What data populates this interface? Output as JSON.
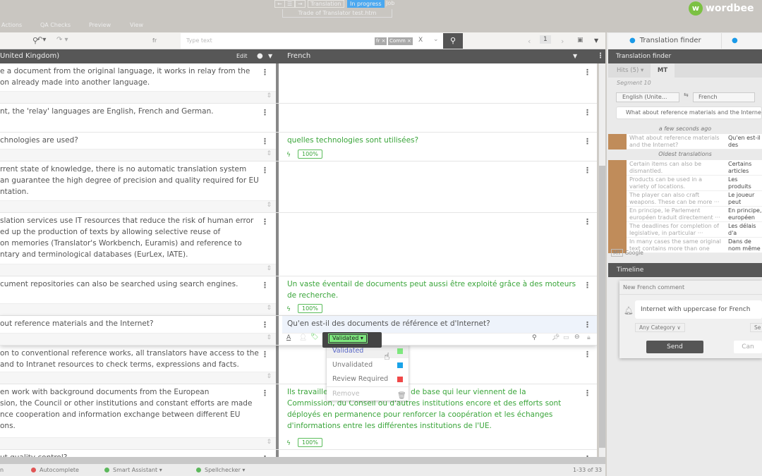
{
  "top": {
    "nav_back": "←",
    "nav_list": "☰",
    "nav_fwd": "→",
    "step": "Translation",
    "status": "In progress",
    "job": "Job",
    "file": "Trade of Translator test.htm",
    "logo": "wordbee"
  },
  "menu": [
    "Actions",
    "QA Checks",
    "Preview",
    "View"
  ],
  "toolbar": {
    "lang": "fr",
    "search_placeholder": "Type text",
    "chips": [
      "fr ×",
      "Comm ×"
    ],
    "clear": "X",
    "page": "1"
  },
  "header": {
    "source": "United Kingdom)",
    "edit": "Edit",
    "target": "French"
  },
  "rows": [
    {
      "src": "e a document from the original language, it works in relay from the\non already made into another language.",
      "tgt": "",
      "h": 57
    },
    {
      "src": "nt, the 'relay' languages are English, French and German.",
      "tgt": "",
      "h": 41
    },
    {
      "src": "chnologies are used?",
      "tgt": "quelles technologies sont utilisées?",
      "badge": "100%",
      "h": 41
    },
    {
      "src": "rrent state of knowledge, there is no automatic translation system\nan guarantee the high degree of precision and quality required for EU\nntation.",
      "tgt": "",
      "h": 73
    },
    {
      "src": "slation services use IT resources that reduce the risk of human error\ned up the production of texts by allowing selective reuse of\non memories (Translator's Workbench, Euramis) and reference to\nntary and terminological databases (EurLex, IATE).",
      "tgt": "",
      "h": 90
    },
    {
      "src": "cument repositories can also be searched using search engines.",
      "tgt": "Un vaste éventail de documents peut aussi être exploité grâce à des moteurs\nde recherche.",
      "badge": "100%",
      "h": 56
    },
    {
      "src": "out reference materials and the Internet?",
      "tgt": "Qu'en est-il des documents de référence et d'Internet?",
      "h": 42,
      "active": true
    },
    {
      "src": "on to conventional reference works, all translators have access to the\nand to Intranet resources to check terms, expressions and facts.",
      "tgt": "",
      "h": 55
    },
    {
      "src": "en work with background documents from the European\nsion, the Council or other institutions and constant efforts are made\nnce cooperation and information exchange between different EU\nons.",
      "tgt": "Ils travaillent sur des documents de base qui leur viennent de la\nCommission, du Conseil ou d'autres institutions encore et des efforts sont\ndéployés en permanence pour renforcer la coopération et les échanges\nd'informations entre les différentes institutions de l'UE.",
      "badge": "100%",
      "h": 93
    },
    {
      "src": "ut quality control?",
      "tgt": "",
      "h": 40
    }
  ],
  "status_dropdown": {
    "selected": "Validated",
    "options": [
      {
        "label": "Validated",
        "color": "#7ee87e"
      },
      {
        "label": "Unvalidated",
        "color": "#1aa3e8"
      },
      {
        "label": "Review Required",
        "color": "#f04848"
      },
      {
        "label": "Remove"
      }
    ]
  },
  "right": {
    "tabs": [
      "Translation finder"
    ],
    "panel_title": "Translation finder",
    "subtabs": [
      "Hits (5) ▾",
      "MT"
    ],
    "segment": "Segment 10",
    "src_lang": "English (Unite...",
    "tgt_lang": "French",
    "query": "What about reference materials and the Internet?",
    "recent_label": "a few seconds ago",
    "oldest_label": "Oldest translations",
    "recent": {
      "src": "What about reference materials and the Internet?",
      "tgt": "Qu'en est-il des documents de référence et"
    },
    "oldest": [
      {
        "src": "Certain items can also be dismantled.",
        "tgt": "Certains articles également êt"
      },
      {
        "src": "Products can be used in a variety of locations.",
        "tgt": "Les produits utilisés dans"
      },
      {
        "src": "The player can also craft weapons. These can be more ···",
        "tgt": "Le joueur peut fabriquer des"
      },
      {
        "src": "En principe, le Parlement européen traduit directement ···",
        "tgt": "En principe, européen tra"
      },
      {
        "src": "The deadlines for completion of legislative, in particular ···",
        "tgt": "Les délais d'a procédures l"
      },
      {
        "src": "In many cases the same original text contains more than one",
        "tgt": "Dans de nom même texte"
      }
    ],
    "mt_badge": "MT",
    "mt_engine": "Google",
    "timeline": "Timeline",
    "comment": {
      "title": "New French comment",
      "text": "Internet with uppercase for French",
      "category": "Any Category ∨",
      "send": "Send",
      "cancel": "Can",
      "sel": "Se"
    }
  },
  "status": {
    "first": "n",
    "items": [
      {
        "label": "Autocomplete",
        "color": "#e05555"
      },
      {
        "label": "Smart Assistant",
        "color": "#5cb85c"
      },
      {
        "label": "Spellchecker",
        "color": "#5cb85c"
      }
    ],
    "count": "1-33 of 33"
  }
}
